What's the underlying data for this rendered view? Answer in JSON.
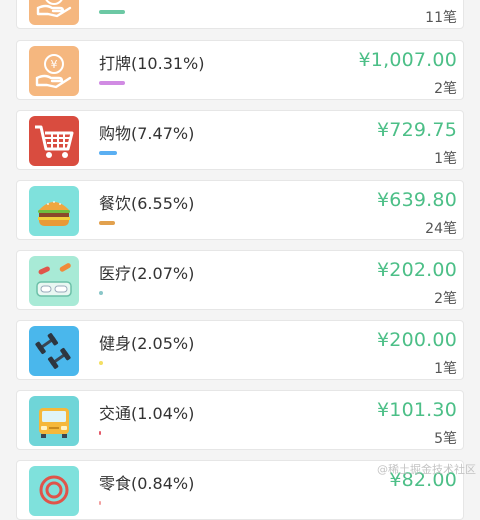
{
  "items": [
    {
      "name": "",
      "amount": "",
      "count": "11笔",
      "icon": "hand-coin-icon",
      "icon_bg": "#f5b77f",
      "bar_color": "#6cc8a4",
      "share": 0.18
    },
    {
      "name": "打牌(10.31%)",
      "amount": "¥1,007.00",
      "count": "2笔",
      "icon": "hand-coin-icon",
      "icon_bg": "#f5b77f",
      "bar_color": "#d18be3",
      "share": 0.1031
    },
    {
      "name": "购物(7.47%)",
      "amount": "¥729.75",
      "count": "1笔",
      "icon": "shopping-cart-icon",
      "icon_bg": "#d94c3f",
      "bar_color": "#5aaff2",
      "share": 0.0747
    },
    {
      "name": "餐饮(6.55%)",
      "amount": "¥639.80",
      "count": "24笔",
      "icon": "burger-icon",
      "icon_bg": "#7fe1dc",
      "bar_color": "#e2a14e",
      "share": 0.0655
    },
    {
      "name": "医疗(2.07%)",
      "amount": "¥202.00",
      "count": "2笔",
      "icon": "medicine-icon",
      "icon_bg": "#a8ead6",
      "bar_color": "#8ac6c8",
      "share": 0.0207
    },
    {
      "name": "健身(2.05%)",
      "amount": "¥200.00",
      "count": "1笔",
      "icon": "dumbbell-icon",
      "icon_bg": "#4ab7ec",
      "bar_color": "#f4df63",
      "share": 0.0205
    },
    {
      "name": "交通(1.04%)",
      "amount": "¥101.30",
      "count": "5笔",
      "icon": "bus-icon",
      "icon_bg": "#6fd5d8",
      "bar_color": "#e45a6a",
      "share": 0.0104
    },
    {
      "name": "零食(0.84%)",
      "amount": "¥82.00",
      "count": "",
      "icon": "snack-icon",
      "icon_bg": "#7fe1dc",
      "bar_color": "#f2a0a0",
      "share": 0.0084
    }
  ],
  "watermark": "@稀土掘金技术社区"
}
